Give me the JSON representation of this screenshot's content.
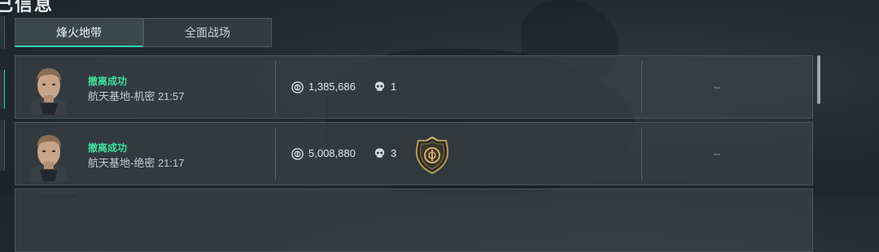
{
  "header": {
    "title": "己信息"
  },
  "tabs": [
    {
      "label": "烽火地带",
      "active": true
    },
    {
      "label": "全面战场",
      "active": false
    }
  ],
  "records": [
    {
      "status": "撤离成功",
      "location": "航天基地-机密 21:57",
      "money": "1,385,686",
      "kills": "1",
      "extra": "--",
      "badge": false
    },
    {
      "status": "撤离成功",
      "location": "航天基地-绝密 21:17",
      "money": "5,008,880",
      "kills": "3",
      "extra": "--",
      "badge": true
    }
  ],
  "colors": {
    "accent": "#30d2b4",
    "success": "#3de09e",
    "badge_gold": "#b89a55"
  },
  "icons": {
    "money": "coin-icon",
    "kills": "skull-icon",
    "badge": "gold-emblem-icon"
  }
}
